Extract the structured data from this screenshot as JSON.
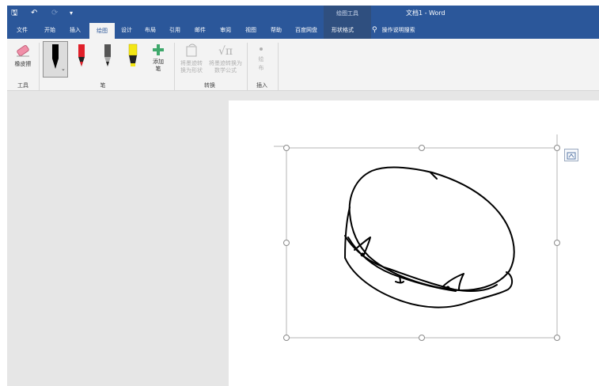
{
  "quick_access": {
    "save": "🖫",
    "undo": "↶",
    "redo": "⟳",
    "more": "▾"
  },
  "title": "文档1 - Word",
  "context_tab_group": "绘图工具",
  "tabs": [
    "文件",
    "开始",
    "插入",
    "绘图",
    "设计",
    "布局",
    "引用",
    "邮件",
    "审阅",
    "视图",
    "帮助",
    "百度网盘",
    "形状格式"
  ],
  "tell_me": "操作说明搜索",
  "ribbon": {
    "eraser_label": "橡皮擦",
    "add_pen_label": "添加笔",
    "ink_to_shape_label": "将墨迹转换为形状",
    "ink_to_math_label": "将墨迹转换为数学公式",
    "insert_label": "绘布",
    "groups": {
      "tools": "工具",
      "pens": "笔",
      "convert": "转换",
      "insert": "插入"
    }
  },
  "colors": {
    "title_bar": "#2b579a",
    "ribbon_bg": "#f3f3f3",
    "pen_black": "#000000",
    "pen_red": "#e0202a",
    "pen_gray": "#555555",
    "highlighter_yellow": "#f3e614"
  }
}
